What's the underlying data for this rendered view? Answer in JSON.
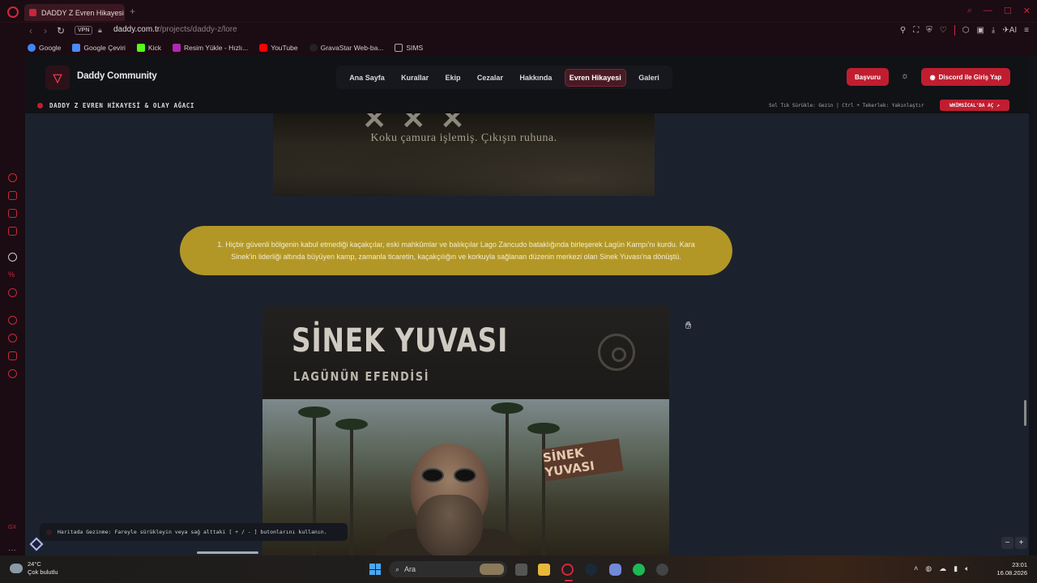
{
  "browser": {
    "tab_title": "DADDY Z Evren Hikayesi &",
    "url_host": "daddy.com.tr",
    "url_path": "/projects/daddy-z/lore",
    "vpn_label": "VPN",
    "ai_label": "AI",
    "bookmarks": [
      {
        "label": "Google",
        "color": "#4285f4"
      },
      {
        "label": "Google Çeviri",
        "color": "#4a8af4"
      },
      {
        "label": "Kick",
        "color": "#53fc18"
      },
      {
        "label": "Resim Yükle - Hızlı...",
        "color": "#b02ab0"
      },
      {
        "label": "YouTube",
        "color": "#ff0000"
      },
      {
        "label": "GravaStar Web-ba...",
        "color": "#222222"
      },
      {
        "label": "SIMS",
        "color": "#888888"
      }
    ]
  },
  "site": {
    "logo_text": "Daddy Community",
    "nav": [
      {
        "label": "Ana Sayfa",
        "active": false
      },
      {
        "label": "Kurallar",
        "active": false
      },
      {
        "label": "Ekip",
        "active": false
      },
      {
        "label": "Cezalar",
        "active": false
      },
      {
        "label": "Hakkında",
        "active": false
      },
      {
        "label": "Evren Hikayesi",
        "active": true
      },
      {
        "label": "Galeri",
        "active": false
      }
    ],
    "apply_button": "Başvuru",
    "discord_button": "Discord ile Giriş Yap",
    "subbar_title": "DADDY Z EVREN HİKAYESİ & OLAY AĞACI",
    "subbar_hint": "Sol Tık Sürükle: Gezin | Ctrl + Tekerlek: Yakınlaştır",
    "whimsical_button": "WHİMSİCAL'DA AÇ",
    "top_image_caption": "Koku çamura işlemiş. Çıkışın ruhuna.",
    "event_text": "1.  Hiçbir güvenli bölgenin kabul etmediği kaçakçılar, eski mahkûmlar ve balıkçılar Lago Zancudo bataklığında birleşerek Lagün Kampı'nı kurdu. Kara Sinek'in liderliği altında büyüyen kamp, zamanla ticaretin, kaçakçılığın ve korkuyla sağlanan düzenin merkezi olan Sinek Yuvası'na dönüştü.",
    "poster_title": "SİNEK YUVASI",
    "poster_subtitle": "LAGÜNÜN EFENDİSİ",
    "poster_sign": "SİNEK YUVASI",
    "map_hint": "Haritada Gezinme: Fareyle sürükleyin veya sağ alttaki [ + / - ] butonlarını kullanın.",
    "zoom_minus": "−",
    "zoom_plus": "+"
  },
  "taskbar": {
    "temp": "24°C",
    "weather": "Çok bulutlu",
    "search_placeholder": "Ara",
    "time": "23:01",
    "date": "16.08.2026"
  }
}
